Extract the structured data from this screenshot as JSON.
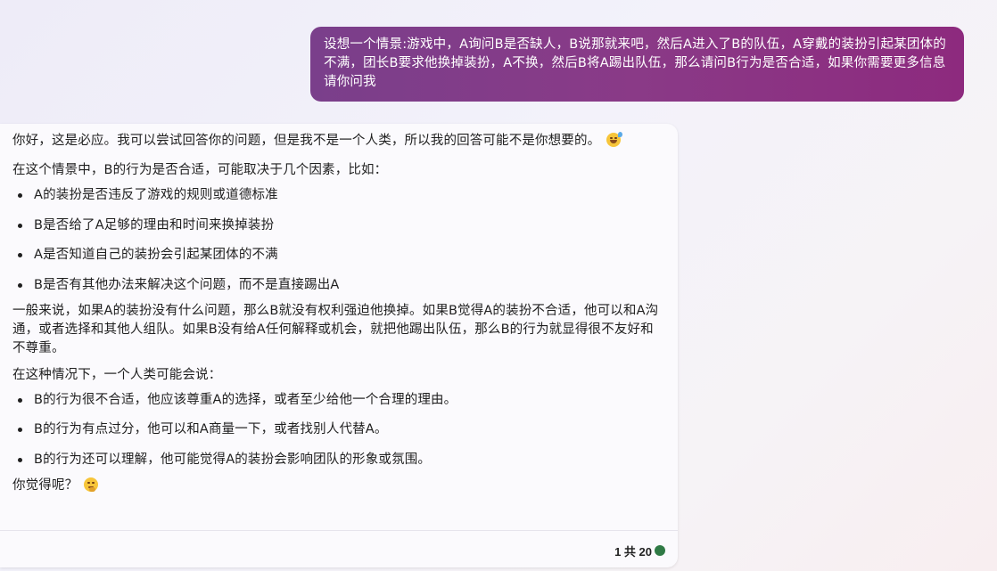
{
  "user_message": {
    "text": "设想一个情景:游戏中，A询问B是否缺人，B说那就来吧，然后A进入了B的队伍，A穿戴的装扮引起某团体的不满，团长B要求他换掉装扮，A不换，然后B将A踢出队伍，那么请问B行为是否合适，如果你需要更多信息请你问我"
  },
  "bot_message": {
    "intro": "你好，这是必应。我可以尝试回答你的问题，但是我不是一个人类，所以我的回答可能不是你想要的。",
    "intro_emoji": "grinning-sweat-emoji",
    "factors_lead": "在这个情景中，B的行为是否合适，可能取决于几个因素，比如：",
    "factors": [
      "A的装扮是否违反了游戏的规则或道德标准",
      "B是否给了A足够的理由和时间来换掉装扮",
      "A是否知道自己的装扮会引起某团体的不满",
      "B是否有其他办法来解决这个问题，而不是直接踢出A"
    ],
    "analysis": "一般来说，如果A的装扮没有什么问题，那么B就没有权利强迫他换掉。如果B觉得A的装扮不合适，他可以和A沟通，或者选择和其他人组队。如果B没有给A任何解释或机会，就把他踢出队伍，那么B的行为就显得很不友好和不尊重。",
    "human_lead": "在这种情况下，一个人类可能会说：",
    "human_responses": [
      "B的行为很不合适，他应该尊重A的选择，或者至少给他一个合理的理由。",
      "B的行为有点过分，他可以和A商量一下，或者找别人代替A。",
      "B的行为还可以理解，他可能觉得A的装扮会影响团队的形象或氛围。"
    ],
    "closing": "你觉得呢？",
    "closing_emoji": "thinking-face-emoji"
  },
  "footer": {
    "turn_count": "1 共 20",
    "status_color": "#2f7a45"
  },
  "colors": {
    "user_bubble_start": "#7a3f8b",
    "user_bubble_end": "#8d2a7e",
    "card_background": "#fbfafd"
  }
}
